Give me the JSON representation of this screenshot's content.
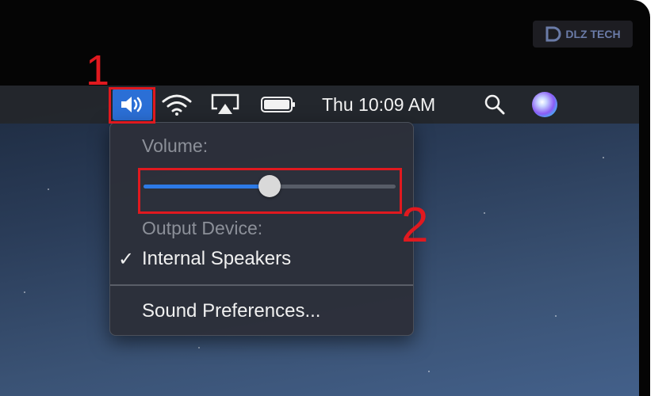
{
  "watermark": {
    "brand": "DLZ TECH"
  },
  "menubar": {
    "volume_icon": "speaker-volume-icon",
    "wifi_icon": "wifi-icon",
    "airplay_icon": "airplay-icon",
    "battery_icon": "battery-icon",
    "clock": "Thu 10:09 AM",
    "search_icon": "spotlight-search-icon",
    "siri_icon": "siri-icon"
  },
  "volume_menu": {
    "volume_label": "Volume:",
    "volume_level": 0.5,
    "output_label": "Output Device:",
    "output_device": "Internal Speakers",
    "check_mark": "✓",
    "preferences": "Sound Preferences..."
  },
  "callouts": [
    {
      "number": "1",
      "color": "#e0191f"
    },
    {
      "number": "2",
      "color": "#e0191f"
    }
  ],
  "colors": {
    "accent": "#2b6fd6",
    "slider_fill": "#2d7ae6",
    "callout": "#e0191f"
  }
}
